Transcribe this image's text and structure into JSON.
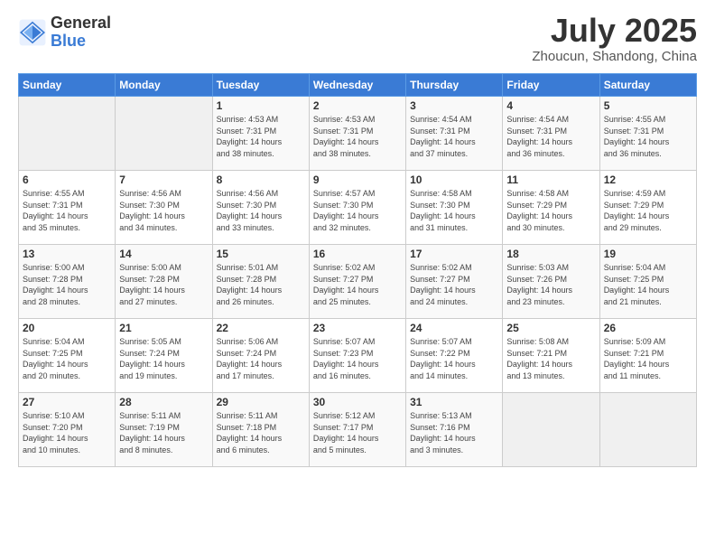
{
  "header": {
    "logo_line1": "General",
    "logo_line2": "Blue",
    "month": "July 2025",
    "location": "Zhoucun, Shandong, China"
  },
  "weekdays": [
    "Sunday",
    "Monday",
    "Tuesday",
    "Wednesday",
    "Thursday",
    "Friday",
    "Saturday"
  ],
  "weeks": [
    [
      {
        "day": "",
        "info": ""
      },
      {
        "day": "",
        "info": ""
      },
      {
        "day": "1",
        "info": "Sunrise: 4:53 AM\nSunset: 7:31 PM\nDaylight: 14 hours\nand 38 minutes."
      },
      {
        "day": "2",
        "info": "Sunrise: 4:53 AM\nSunset: 7:31 PM\nDaylight: 14 hours\nand 38 minutes."
      },
      {
        "day": "3",
        "info": "Sunrise: 4:54 AM\nSunset: 7:31 PM\nDaylight: 14 hours\nand 37 minutes."
      },
      {
        "day": "4",
        "info": "Sunrise: 4:54 AM\nSunset: 7:31 PM\nDaylight: 14 hours\nand 36 minutes."
      },
      {
        "day": "5",
        "info": "Sunrise: 4:55 AM\nSunset: 7:31 PM\nDaylight: 14 hours\nand 36 minutes."
      }
    ],
    [
      {
        "day": "6",
        "info": "Sunrise: 4:55 AM\nSunset: 7:31 PM\nDaylight: 14 hours\nand 35 minutes."
      },
      {
        "day": "7",
        "info": "Sunrise: 4:56 AM\nSunset: 7:30 PM\nDaylight: 14 hours\nand 34 minutes."
      },
      {
        "day": "8",
        "info": "Sunrise: 4:56 AM\nSunset: 7:30 PM\nDaylight: 14 hours\nand 33 minutes."
      },
      {
        "day": "9",
        "info": "Sunrise: 4:57 AM\nSunset: 7:30 PM\nDaylight: 14 hours\nand 32 minutes."
      },
      {
        "day": "10",
        "info": "Sunrise: 4:58 AM\nSunset: 7:30 PM\nDaylight: 14 hours\nand 31 minutes."
      },
      {
        "day": "11",
        "info": "Sunrise: 4:58 AM\nSunset: 7:29 PM\nDaylight: 14 hours\nand 30 minutes."
      },
      {
        "day": "12",
        "info": "Sunrise: 4:59 AM\nSunset: 7:29 PM\nDaylight: 14 hours\nand 29 minutes."
      }
    ],
    [
      {
        "day": "13",
        "info": "Sunrise: 5:00 AM\nSunset: 7:28 PM\nDaylight: 14 hours\nand 28 minutes."
      },
      {
        "day": "14",
        "info": "Sunrise: 5:00 AM\nSunset: 7:28 PM\nDaylight: 14 hours\nand 27 minutes."
      },
      {
        "day": "15",
        "info": "Sunrise: 5:01 AM\nSunset: 7:28 PM\nDaylight: 14 hours\nand 26 minutes."
      },
      {
        "day": "16",
        "info": "Sunrise: 5:02 AM\nSunset: 7:27 PM\nDaylight: 14 hours\nand 25 minutes."
      },
      {
        "day": "17",
        "info": "Sunrise: 5:02 AM\nSunset: 7:27 PM\nDaylight: 14 hours\nand 24 minutes."
      },
      {
        "day": "18",
        "info": "Sunrise: 5:03 AM\nSunset: 7:26 PM\nDaylight: 14 hours\nand 23 minutes."
      },
      {
        "day": "19",
        "info": "Sunrise: 5:04 AM\nSunset: 7:25 PM\nDaylight: 14 hours\nand 21 minutes."
      }
    ],
    [
      {
        "day": "20",
        "info": "Sunrise: 5:04 AM\nSunset: 7:25 PM\nDaylight: 14 hours\nand 20 minutes."
      },
      {
        "day": "21",
        "info": "Sunrise: 5:05 AM\nSunset: 7:24 PM\nDaylight: 14 hours\nand 19 minutes."
      },
      {
        "day": "22",
        "info": "Sunrise: 5:06 AM\nSunset: 7:24 PM\nDaylight: 14 hours\nand 17 minutes."
      },
      {
        "day": "23",
        "info": "Sunrise: 5:07 AM\nSunset: 7:23 PM\nDaylight: 14 hours\nand 16 minutes."
      },
      {
        "day": "24",
        "info": "Sunrise: 5:07 AM\nSunset: 7:22 PM\nDaylight: 14 hours\nand 14 minutes."
      },
      {
        "day": "25",
        "info": "Sunrise: 5:08 AM\nSunset: 7:21 PM\nDaylight: 14 hours\nand 13 minutes."
      },
      {
        "day": "26",
        "info": "Sunrise: 5:09 AM\nSunset: 7:21 PM\nDaylight: 14 hours\nand 11 minutes."
      }
    ],
    [
      {
        "day": "27",
        "info": "Sunrise: 5:10 AM\nSunset: 7:20 PM\nDaylight: 14 hours\nand 10 minutes."
      },
      {
        "day": "28",
        "info": "Sunrise: 5:11 AM\nSunset: 7:19 PM\nDaylight: 14 hours\nand 8 minutes."
      },
      {
        "day": "29",
        "info": "Sunrise: 5:11 AM\nSunset: 7:18 PM\nDaylight: 14 hours\nand 6 minutes."
      },
      {
        "day": "30",
        "info": "Sunrise: 5:12 AM\nSunset: 7:17 PM\nDaylight: 14 hours\nand 5 minutes."
      },
      {
        "day": "31",
        "info": "Sunrise: 5:13 AM\nSunset: 7:16 PM\nDaylight: 14 hours\nand 3 minutes."
      },
      {
        "day": "",
        "info": ""
      },
      {
        "day": "",
        "info": ""
      }
    ]
  ]
}
